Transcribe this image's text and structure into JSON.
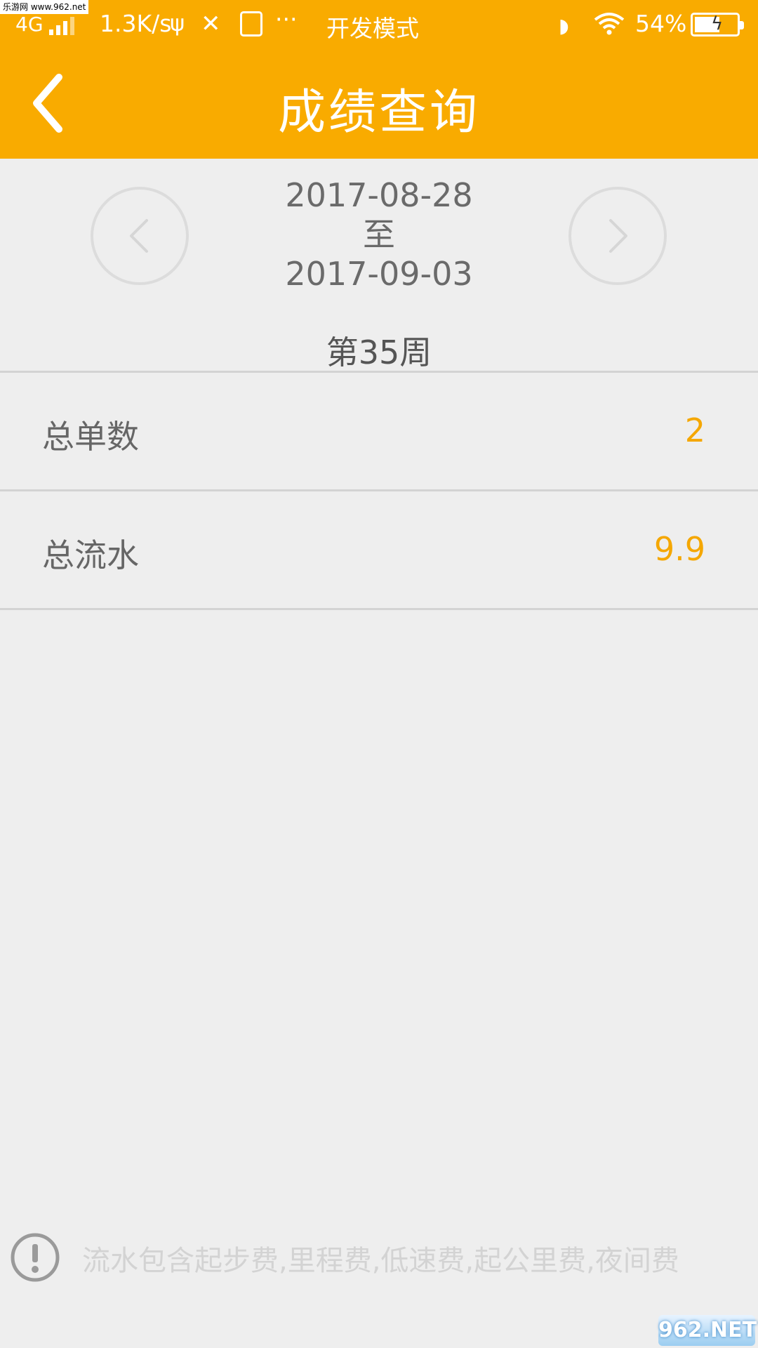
{
  "status_bar": {
    "watermark": "乐游网 www.962.net",
    "network": "4G",
    "speed": "1.3K/s",
    "more": "···",
    "mode": "开发模式",
    "battery": "54%"
  },
  "header": {
    "title": "成绩查询"
  },
  "week_selector": {
    "start_date": "2017-08-28",
    "to": "至",
    "end_date": "2017-09-03",
    "week": "第35周"
  },
  "stats": [
    {
      "label": "总单数",
      "value": "2"
    },
    {
      "label": "总流水",
      "value": "9.9"
    }
  ],
  "footer": {
    "note": "流水包含起步费,里程费,低速费,起公里费,夜间费"
  },
  "watermark_bottom": "962.NET",
  "colors": {
    "accent": "#f9ab00",
    "value": "#f5a700",
    "background": "#eeeeee",
    "divider": "#d3d3d3"
  }
}
